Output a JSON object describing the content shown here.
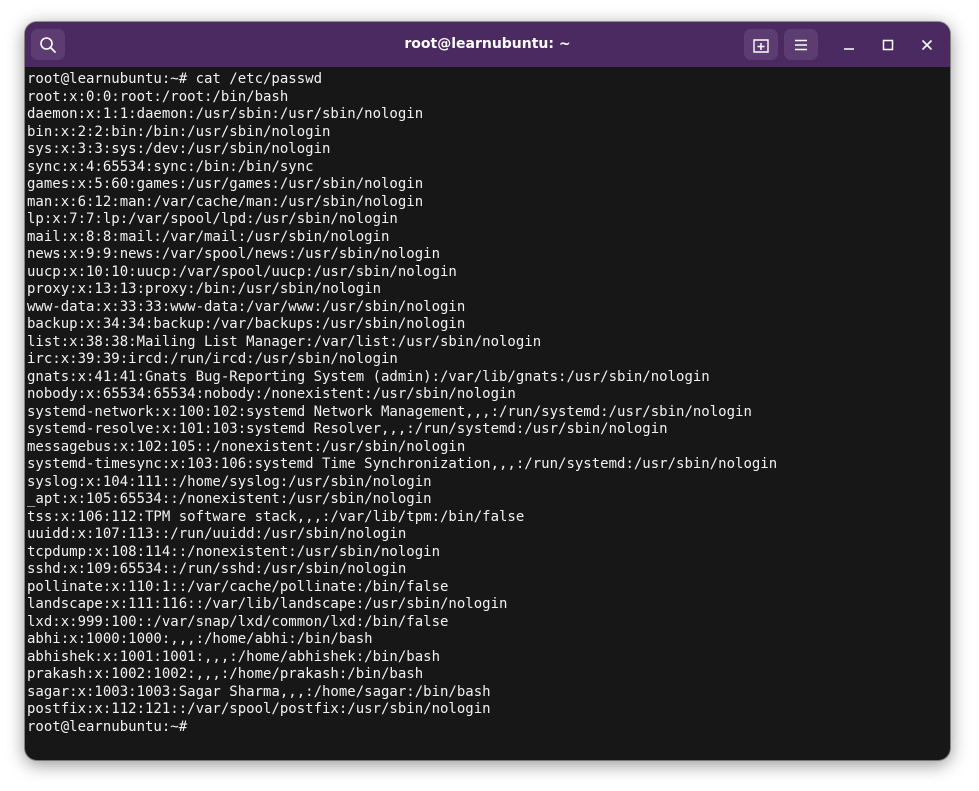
{
  "window": {
    "title": "root@learnubuntu: ~"
  },
  "icons": {
    "search": "search-icon",
    "new_tab": "new-tab-icon",
    "menu": "hamburger-menu-icon",
    "minimize": "minimize-icon",
    "maximize": "maximize-icon",
    "close": "close-icon"
  },
  "colors": {
    "titlebar": "#4b2a61",
    "terminal_bg": "#171717",
    "terminal_fg": "#f2f2f2"
  },
  "terminal": {
    "lines": [
      "root@learnubuntu:~# cat /etc/passwd",
      "root:x:0:0:root:/root:/bin/bash",
      "daemon:x:1:1:daemon:/usr/sbin:/usr/sbin/nologin",
      "bin:x:2:2:bin:/bin:/usr/sbin/nologin",
      "sys:x:3:3:sys:/dev:/usr/sbin/nologin",
      "sync:x:4:65534:sync:/bin:/bin/sync",
      "games:x:5:60:games:/usr/games:/usr/sbin/nologin",
      "man:x:6:12:man:/var/cache/man:/usr/sbin/nologin",
      "lp:x:7:7:lp:/var/spool/lpd:/usr/sbin/nologin",
      "mail:x:8:8:mail:/var/mail:/usr/sbin/nologin",
      "news:x:9:9:news:/var/spool/news:/usr/sbin/nologin",
      "uucp:x:10:10:uucp:/var/spool/uucp:/usr/sbin/nologin",
      "proxy:x:13:13:proxy:/bin:/usr/sbin/nologin",
      "www-data:x:33:33:www-data:/var/www:/usr/sbin/nologin",
      "backup:x:34:34:backup:/var/backups:/usr/sbin/nologin",
      "list:x:38:38:Mailing List Manager:/var/list:/usr/sbin/nologin",
      "irc:x:39:39:ircd:/run/ircd:/usr/sbin/nologin",
      "gnats:x:41:41:Gnats Bug-Reporting System (admin):/var/lib/gnats:/usr/sbin/nologin",
      "nobody:x:65534:65534:nobody:/nonexistent:/usr/sbin/nologin",
      "systemd-network:x:100:102:systemd Network Management,,,:/run/systemd:/usr/sbin/nologin",
      "systemd-resolve:x:101:103:systemd Resolver,,,:/run/systemd:/usr/sbin/nologin",
      "messagebus:x:102:105::/nonexistent:/usr/sbin/nologin",
      "systemd-timesync:x:103:106:systemd Time Synchronization,,,:/run/systemd:/usr/sbin/nologin",
      "syslog:x:104:111::/home/syslog:/usr/sbin/nologin",
      "_apt:x:105:65534::/nonexistent:/usr/sbin/nologin",
      "tss:x:106:112:TPM software stack,,,:/var/lib/tpm:/bin/false",
      "uuidd:x:107:113::/run/uuidd:/usr/sbin/nologin",
      "tcpdump:x:108:114::/nonexistent:/usr/sbin/nologin",
      "sshd:x:109:65534::/run/sshd:/usr/sbin/nologin",
      "pollinate:x:110:1::/var/cache/pollinate:/bin/false",
      "landscape:x:111:116::/var/lib/landscape:/usr/sbin/nologin",
      "lxd:x:999:100::/var/snap/lxd/common/lxd:/bin/false",
      "abhi:x:1000:1000:,,,:/home/abhi:/bin/bash",
      "abhishek:x:1001:1001:,,,:/home/abhishek:/bin/bash",
      "prakash:x:1002:1002:,,,:/home/prakash:/bin/bash",
      "sagar:x:1003:1003:Sagar Sharma,,,:/home/sagar:/bin/bash",
      "postfix:x:112:121::/var/spool/postfix:/usr/sbin/nologin",
      "root@learnubuntu:~# "
    ]
  }
}
